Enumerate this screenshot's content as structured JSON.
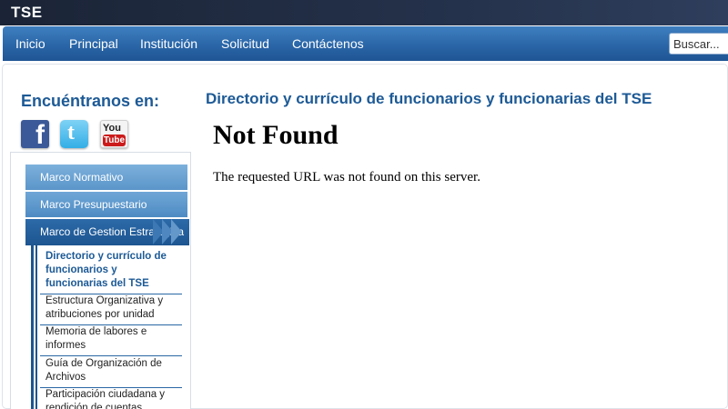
{
  "header": {
    "logo": "TSE"
  },
  "nav": {
    "items": [
      "Inicio",
      "Principal",
      "Institución",
      "Solicitud",
      "Contáctenos"
    ],
    "search_placeholder": "Buscar..."
  },
  "sidebar": {
    "find_us": "Encuéntranos en:",
    "social": [
      {
        "icon": "facebook-icon",
        "label": "f"
      },
      {
        "icon": "twitter-icon",
        "label": "t"
      },
      {
        "icon": "youtube-icon",
        "label_top": "You",
        "label_bottom": "Tube"
      }
    ],
    "menu": [
      {
        "label": "Marco Normativo"
      },
      {
        "label": "Marco Presupuestario"
      },
      {
        "label": "Marco de Gestion Estrategica",
        "active": true
      }
    ],
    "submenu": [
      {
        "label": "Directorio y currículo de funcionarios y funcionarias del TSE",
        "active": true
      },
      {
        "label": "Estructura Organizativa y atribuciones por unidad"
      },
      {
        "label": "Memoria de labores e informes"
      },
      {
        "label": "Guía de Organización de Archivos"
      },
      {
        "label": "Participación ciudadana y rendición de cuentas"
      }
    ]
  },
  "main": {
    "heading": "Directorio y currículo de funcionarios y funcionarias del TSE",
    "error_title": "Not Found",
    "error_message": "The requested URL was not found on this server."
  },
  "colors": {
    "nav_bg": "#2a66a8",
    "heading": "#1d5a96",
    "menu_active": "#1d5590",
    "menu_inactive": "#5a95c9"
  }
}
